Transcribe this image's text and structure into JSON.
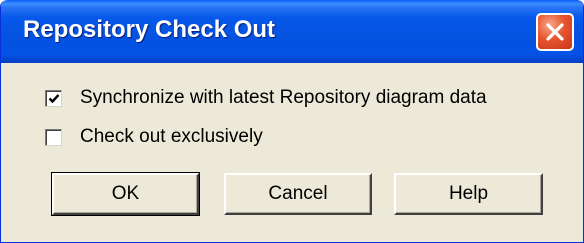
{
  "window": {
    "title": "Repository Check Out",
    "close_icon": "close-x-icon"
  },
  "options": {
    "synchronize": {
      "label": "Synchronize with latest Repository diagram data",
      "checked": true
    },
    "exclusive": {
      "label": "Check out exclusively",
      "checked": false
    }
  },
  "buttons": {
    "ok": "OK",
    "cancel": "Cancel",
    "help": "Help"
  },
  "colors": {
    "titlebar": "#0553e3",
    "dialog_bg": "#ece9d8",
    "close_button": "#e0522e"
  }
}
